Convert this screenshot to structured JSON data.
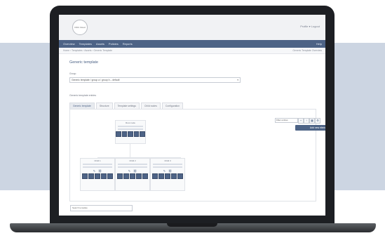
{
  "header": {
    "logo_text": "DDC Cloud",
    "user_text": "Profile ▾  Logout"
  },
  "nav": {
    "items": [
      "Overview",
      "Templates",
      "Assets",
      "Policies",
      "Reports"
    ],
    "right_text": "Help"
  },
  "breadcrumb": {
    "path": "Home › Templates › Assets › Generic Template",
    "right_text": "Generic Template Overview"
  },
  "page": {
    "title": "Generic template",
    "group_label": "Group",
    "group_value": "Generic template / group a / group b – default",
    "section_label": "Generic template entries"
  },
  "tabs": [
    {
      "label": "Generic template"
    },
    {
      "label": "Structure"
    },
    {
      "label": "Template settings"
    },
    {
      "label": "Child nodes"
    },
    {
      "label": "Configuration"
    }
  ],
  "toolbar": {
    "filter_placeholder": "Filter entries",
    "primary_label": "Add new element"
  },
  "nodes": {
    "top": {
      "title": "Root node"
    },
    "children": [
      {
        "title": "Child 1"
      },
      {
        "title": "Child 2"
      },
      {
        "title": "Child 3"
      }
    ]
  },
  "footer": {
    "input_placeholder": "Search template"
  },
  "icons": {
    "logo": "ddc-logo",
    "select_arrow": "chevron-down-icon",
    "add": "plus-icon",
    "upload": "upload-icon",
    "grid": "grid-icon",
    "settings": "gear-icon"
  }
}
